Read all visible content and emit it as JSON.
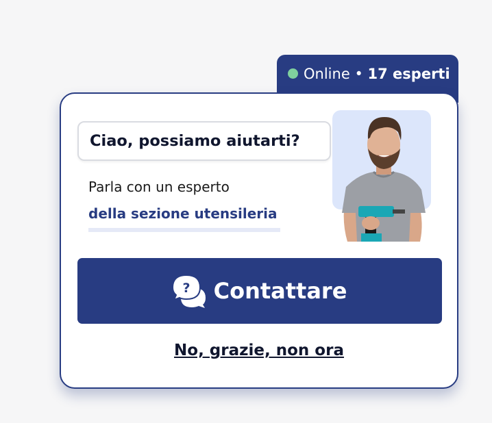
{
  "status": {
    "online_label": "Online",
    "separator": "•",
    "experts_count": "17 esperti"
  },
  "widget": {
    "greeting": "Ciao, possiamo aiutarti?",
    "subtitle": "Parla con un esperto",
    "department_link": "della sezione utensileria",
    "cta_label": "Contattare",
    "cta_icon": "chat-bubbles-question-icon",
    "dismiss_label": "No, grazie, non ora"
  },
  "colors": {
    "primary": "#283c82",
    "online_dot": "#7fd09e",
    "background": "#f6f6f7"
  }
}
